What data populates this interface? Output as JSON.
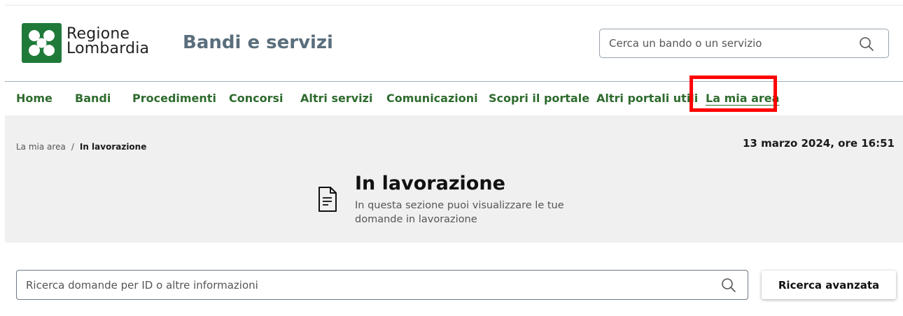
{
  "header": {
    "logo_line1": "Regione",
    "logo_line2": "Lombardia",
    "site_title": "Bandi e servizi",
    "search_placeholder": "Cerca un bando o un servizio"
  },
  "nav": {
    "items": [
      "Home",
      "Bandi",
      "Procedimenti",
      "Concorsi",
      "Altri servizi",
      "Comunicazioni",
      "Scopri il portale",
      "Altri portali utili",
      "La mia area"
    ],
    "active": "La mia area"
  },
  "breadcrumb": {
    "parent": "La mia area",
    "separator": "/",
    "current": "In lavorazione"
  },
  "datetime": "13 marzo 2024, ore 16:51",
  "page": {
    "title": "In lavorazione",
    "subtitle": "In questa sezione puoi visualizzare le tue domande in lavorazione"
  },
  "results_search": {
    "placeholder": "Ricerca domande per ID o altre informazioni",
    "advanced_button": "Ricerca avanzata"
  },
  "colors": {
    "brand_green": "#1f7a3a",
    "nav_green": "#2e6b2e",
    "title_gray": "#5a6e7c",
    "highlight_red": "#ff0000",
    "band_bg": "#f0f0f0"
  }
}
